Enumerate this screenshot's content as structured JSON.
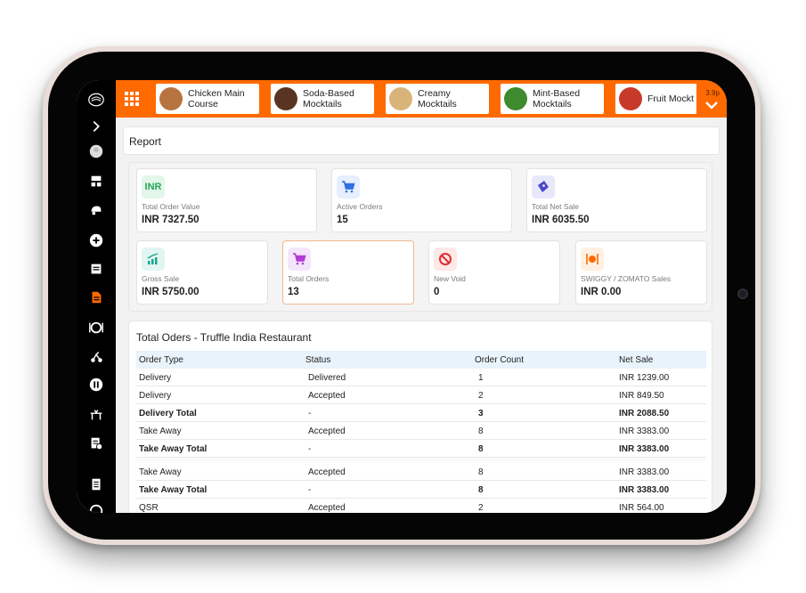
{
  "topbar": {
    "categories": [
      {
        "line1": "Chicken Main",
        "line2": "Course",
        "color": "#b87440"
      },
      {
        "line1": "Soda-Based",
        "line2": "Mocktails",
        "color": "#5a3422"
      },
      {
        "line1": "Creamy",
        "line2": "Mocktails",
        "color": "#d9b47a"
      },
      {
        "line1": "Mint-Based",
        "line2": "Mocktails",
        "color": "#3e8a2e"
      },
      {
        "line1": "Fruit Mockt",
        "line2": "",
        "color": "#c73a2a"
      }
    ],
    "version": "3.9p"
  },
  "report": {
    "title": "Report"
  },
  "stats": [
    {
      "icon": "inr-icon",
      "icon_text": "INR",
      "label": "Total Order Value",
      "value": "INR  7327.50",
      "icon_bg": "#e3f6ea"
    },
    {
      "icon": "cart-icon",
      "label": "Active Orders",
      "value": "15",
      "icon_bg": "#e6efff"
    },
    {
      "icon": "ticket-icon",
      "label": "Total Net Sale",
      "value": "INR  6035.50",
      "icon_bg": "#e9e8fb"
    },
    {
      "icon": "chart-up-icon",
      "label": "Gross Sale",
      "value": "INR  5750.00",
      "icon_bg": "#e1f5f2"
    },
    {
      "icon": "cart-icon",
      "label": "Total Orders",
      "value": "13",
      "icon_bg": "#f3e6fb"
    },
    {
      "icon": "no-entry-icon",
      "label": "New Void",
      "value": "0",
      "icon_bg": "#fde8e8"
    },
    {
      "icon": "dining-icon",
      "label": "SWIGGY / ZOMATO Sales",
      "value": "INR  0.00",
      "icon_bg": "#fff0e3"
    }
  ],
  "table": {
    "title": "Total Oders - Truffle India Restaurant",
    "headers": [
      "Order Type",
      "Status",
      "Order Count",
      "Net Sale"
    ],
    "rows": [
      {
        "type": "Delivery",
        "status": "Delivered",
        "count": "1",
        "net": "INR  1239.00",
        "total": false
      },
      {
        "type": "Delivery",
        "status": "Accepted",
        "count": "2",
        "net": "INR  849.50",
        "total": false
      },
      {
        "type": "Delivery Total",
        "status": "-",
        "count": "3",
        "net": "INR  2088.50",
        "total": true
      },
      {
        "type": "Take Away",
        "status": "Accepted",
        "count": "8",
        "net": "INR  3383.00",
        "total": false
      },
      {
        "type": "Take Away Total",
        "status": "-",
        "count": "8",
        "net": "INR  3383.00",
        "total": true
      },
      {
        "type": "Take Away",
        "status": "Accepted",
        "count": "8",
        "net": "INR  3383.00",
        "total": false
      },
      {
        "type": "Take Away Total",
        "status": "-",
        "count": "8",
        "net": "INR  3383.00",
        "total": true
      },
      {
        "type": "QSR",
        "status": "Accepted",
        "count": "2",
        "net": "INR  564.00",
        "total": false
      }
    ]
  },
  "colors": {
    "accent": "#ff6a00",
    "sidebar": "#000000",
    "active_card_border": "#f3b58c"
  }
}
